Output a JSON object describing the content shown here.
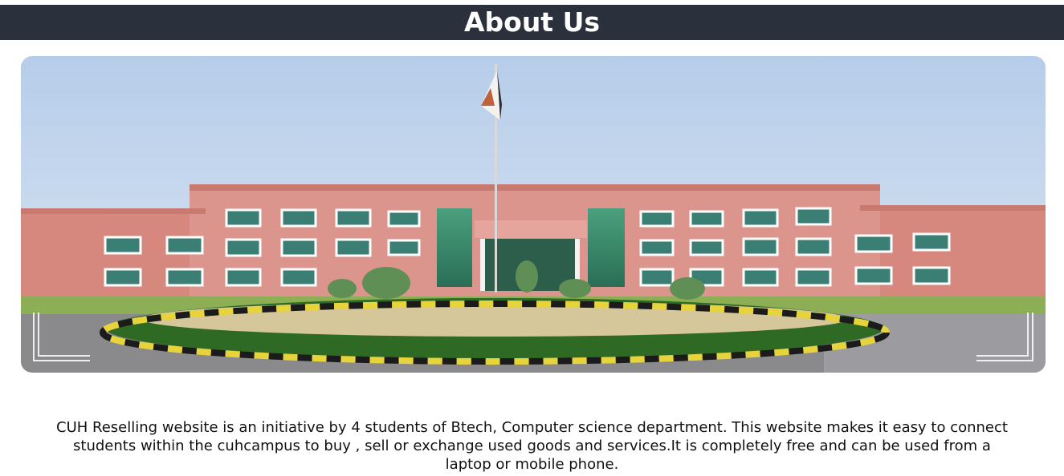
{
  "page": {
    "title": "About Us",
    "description": "CUH Reselling website is an initiative by 4 students of Btech, Computer science department. This website makes it easy to connect students within the cuhcampus to buy , sell or exchange used goods and services.It is completely free and can be used from a laptop or mobile phone."
  },
  "colors": {
    "header_bg": "#2b303d",
    "header_text": "#ffffff",
    "sky": "#c9daf0",
    "building": "#d98f86",
    "glass": "#3e8f6f",
    "hedge": "#2f6a24"
  }
}
